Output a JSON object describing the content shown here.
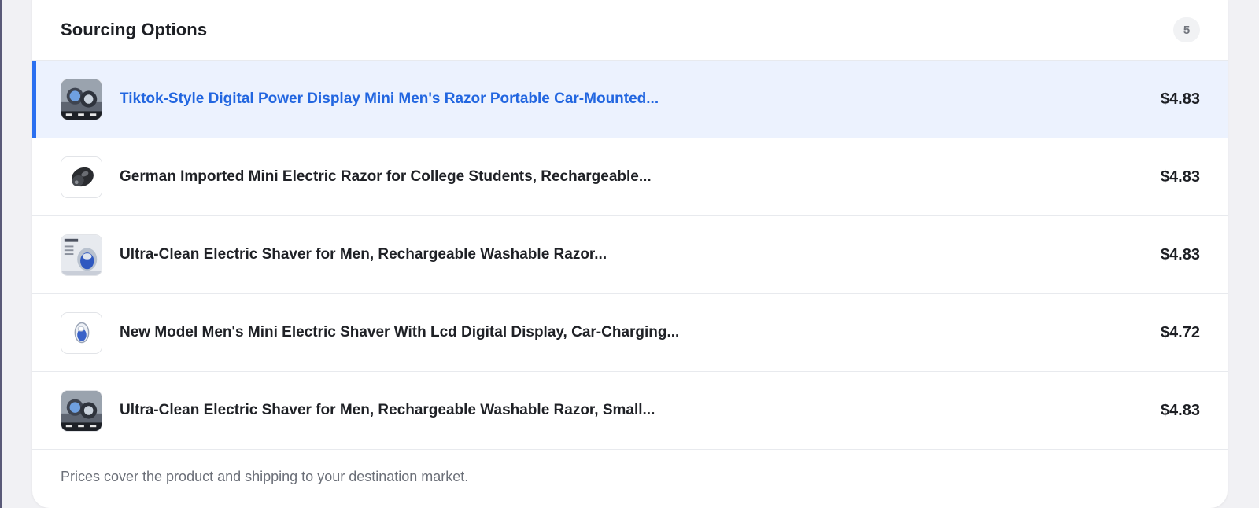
{
  "panel": {
    "title": "Sourcing Options",
    "count": "5",
    "footer_note": "Prices cover the product and shipping to your destination market."
  },
  "options": [
    {
      "title": "Tiktok-Style Digital Power Display Mini Men's Razor Portable Car-Mounted...",
      "price": "$4.83",
      "selected": true,
      "thumb_icon": "mini-razor-dark-product-icon"
    },
    {
      "title": "German Imported Mini Electric Razor for College Students, Rechargeable...",
      "price": "$4.83",
      "selected": false,
      "thumb_icon": "black-razor-product-icon"
    },
    {
      "title": "Ultra-Clean Electric Shaver for Men, Rechargeable Washable Razor...",
      "price": "$4.83",
      "selected": false,
      "thumb_icon": "blue-shaver-product-icon"
    },
    {
      "title": "New Model Men's Mini Electric Shaver With Lcd Digital Display, Car-Charging...",
      "price": "$4.72",
      "selected": false,
      "thumb_icon": "white-shaver-product-icon"
    },
    {
      "title": "Ultra-Clean Electric Shaver for Men, Rechargeable Washable Razor, Small...",
      "price": "$4.83",
      "selected": false,
      "thumb_icon": "mini-razor-dark-product-icon"
    }
  ],
  "colors": {
    "accent": "#2a6ff0",
    "selected_bg": "#ecf2fe",
    "selected_text": "#2266e0"
  }
}
